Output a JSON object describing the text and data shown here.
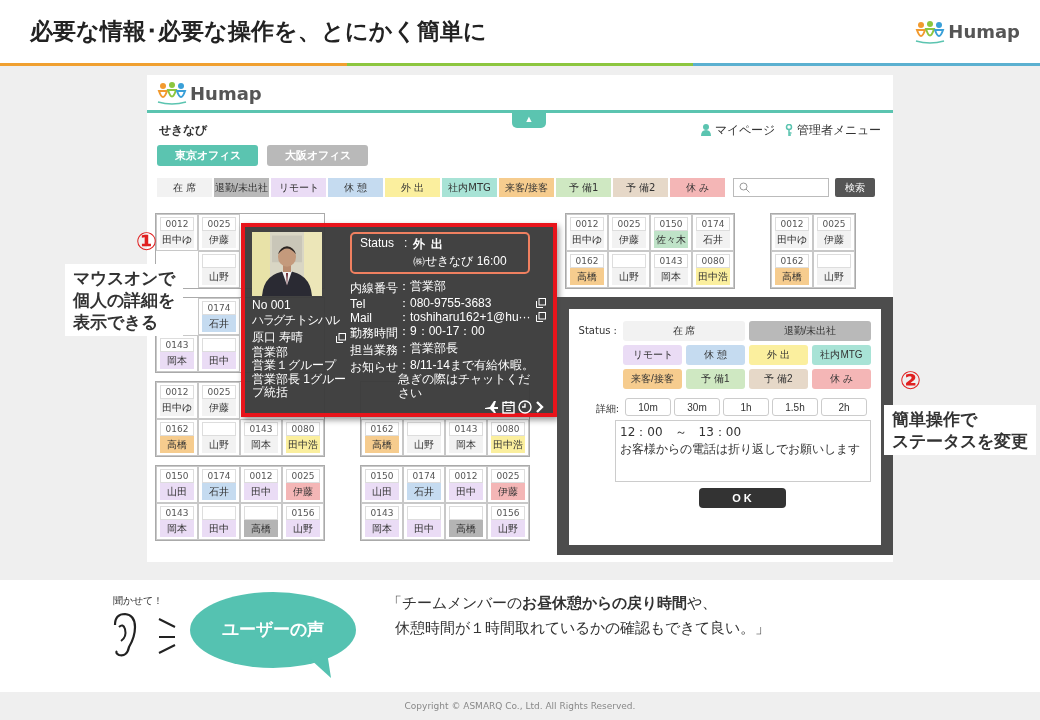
{
  "slide": {
    "title": "必要な情報･必要な操作を、とにかく簡単に",
    "brand": "Humap"
  },
  "app": {
    "brand": "Humap",
    "collapse_tab": "▲",
    "page_title": "せきなび",
    "nav": [
      {
        "label": "マイページ",
        "kind": "user"
      },
      {
        "label": "管理者メニュー",
        "kind": "key"
      }
    ],
    "offices": [
      {
        "label": "東京オフィス",
        "selected": true
      },
      {
        "label": "大阪オフィス",
        "selected": false
      }
    ],
    "legend": [
      {
        "label": "在 席",
        "color": "#f2f2f2"
      },
      {
        "label": "退勤/未出社",
        "color": "#b9b9b9"
      },
      {
        "label": "リモート",
        "color": "#eadcf5"
      },
      {
        "label": "休 憩",
        "color": "#c5dbf0"
      },
      {
        "label": "外 出",
        "color": "#fbef9e"
      },
      {
        "label": "社内MTG",
        "color": "#a8e3d6"
      },
      {
        "label": "来客/接客",
        "color": "#f6cc8e"
      },
      {
        "label": "予 備1",
        "color": "#cfe8c2"
      },
      {
        "label": "予 備2",
        "color": "#e6d8c8"
      },
      {
        "label": "休 み",
        "color": "#f4b6b6"
      }
    ],
    "search": {
      "button": "検索"
    },
    "desk_rows": [
      [
        {
          "cells": [
            {
              "no": "0012",
              "name": "田中ゆ",
              "color": "#f2f2f2"
            },
            {
              "no": "0025",
              "name": "伊藤",
              "color": "#f2f2f2"
            },
            null,
            null,
            null,
            {
              "name": "山野",
              "color": "#f2f2f2"
            },
            null,
            null
          ]
        },
        null,
        {
          "cells": [
            {
              "no": "0012",
              "name": "田中ゆ",
              "color": "#f2f2f2"
            },
            {
              "no": "0025",
              "name": "伊藤",
              "color": "#f2f2f2"
            },
            {
              "no": "0150",
              "name": "佐々木",
              "color": "#bfe3c8"
            },
            {
              "no": "0174",
              "name": "石井",
              "color": "#f2f2f2"
            },
            {
              "no": "0162",
              "name": "高橋",
              "color": "#f6cc8e"
            },
            {
              "name": "山野",
              "color": "#f2f2f2"
            },
            {
              "no": "0143",
              "name": "岡本",
              "color": "#f2f2f2"
            },
            {
              "no": "0080",
              "name": "田中浩",
              "color": "#fbef9e"
            }
          ]
        },
        {
          "cells": [
            {
              "no": "0012",
              "name": "田中ゆ",
              "color": "#f2f2f2"
            },
            {
              "no": "0025",
              "name": "伊藤",
              "color": "#f2f2f2"
            },
            {
              "no": "0162",
              "name": "高橋",
              "color": "#f6cc8e"
            },
            {
              "name": "山野",
              "color": "#f2f2f2"
            }
          ]
        }
      ],
      [
        {
          "cells": [
            null,
            {
              "no": "0174",
              "name": "石井",
              "color": "#c5dbf0"
            },
            null,
            null,
            {
              "no": "0143",
              "name": "岡本",
              "color": "#eadcf5"
            },
            {
              "name": "田中",
              "color": "#eadcf5"
            },
            null,
            null
          ]
        },
        null,
        null,
        null
      ],
      [
        {
          "cells": [
            {
              "no": "0012",
              "name": "田中ゆ",
              "color": "#f2f2f2"
            },
            {
              "no": "0025",
              "name": "伊藤",
              "color": "#f2f2f2"
            },
            null,
            null,
            {
              "no": "0162",
              "name": "高橋",
              "color": "#f6cc8e"
            },
            {
              "name": "山野",
              "color": "#f2f2f2"
            },
            {
              "no": "0143",
              "name": "岡本",
              "color": "#f2f2f2"
            },
            {
              "no": "0080",
              "name": "田中浩",
              "color": "#fbef9e"
            }
          ]
        },
        {
          "cells": [
            null,
            null,
            null,
            null,
            {
              "no": "0162",
              "name": "高橋",
              "color": "#f6cc8e"
            },
            {
              "name": "山野",
              "color": "#f2f2f2"
            },
            {
              "no": "0143",
              "name": "岡本",
              "color": "#f2f2f2"
            },
            {
              "no": "0080",
              "name": "田中浩",
              "color": "#fbef9e"
            }
          ]
        },
        null,
        null
      ],
      [
        {
          "cells": [
            {
              "no": "0150",
              "name": "山田",
              "color": "#eadcf5"
            },
            {
              "no": "0174",
              "name": "石井",
              "color": "#c5dbf0"
            },
            {
              "no": "0012",
              "name": "田中",
              "color": "#eadcf5"
            },
            {
              "no": "0025",
              "name": "伊藤",
              "color": "#f4b6b6"
            },
            {
              "no": "0143",
              "name": "岡本",
              "color": "#eadcf5"
            },
            {
              "name": "田中",
              "color": "#eadcf5"
            },
            {
              "name": "高橋",
              "color": "#b4b4b4"
            },
            {
              "no": "0156",
              "name": "山野",
              "color": "#eadcf5"
            }
          ]
        },
        {
          "cells": [
            {
              "no": "0150",
              "name": "山田",
              "color": "#eadcf5"
            },
            {
              "no": "0174",
              "name": "石井",
              "color": "#c5dbf0"
            },
            {
              "no": "0012",
              "name": "田中",
              "color": "#eadcf5"
            },
            {
              "no": "0025",
              "name": "伊藤",
              "color": "#f4b6b6"
            },
            {
              "no": "0143",
              "name": "岡本",
              "color": "#eadcf5"
            },
            {
              "name": "田中",
              "color": "#eadcf5"
            },
            {
              "name": "高橋",
              "color": "#b4b4b4"
            },
            {
              "no": "0156",
              "name": "山野",
              "color": "#eadcf5"
            }
          ]
        },
        null,
        null
      ]
    ]
  },
  "profile_popup": {
    "number": "No 001",
    "kana": "ハラグチ トシハル",
    "name": "原口 寿晴",
    "department_lines": [
      "営業部",
      "営業１グループ",
      "営業部長 1グループ統括"
    ],
    "status_label": "Status",
    "status_separator": ":",
    "status": "外 出",
    "status_detail": "㈱せきなび 16:00",
    "fields": [
      {
        "label": "内線番号",
        "value": "：営業部",
        "copy": false
      },
      {
        "label": "Tel",
        "value": "：080-9755-3683",
        "copy": true
      },
      {
        "label": "Mail",
        "value": "：toshiharu162+1@hu···",
        "copy": true
      },
      {
        "label": "勤務時間",
        "value": "：9：00-17：00",
        "copy": false
      },
      {
        "label": "担当業務",
        "value": "：営業部長",
        "copy": false
      },
      {
        "label": "お知らせ",
        "value": "：8/11-14まで有給休暇。急ぎの際はチャットください",
        "copy": false
      }
    ]
  },
  "status_dialog": {
    "status_label": "Status :",
    "statuses": [
      {
        "label": "在 席",
        "color": "#f2f2f2",
        "kind": "wide"
      },
      {
        "label": "退勤/未出社",
        "color": "#b9b9b9",
        "kind": "wide"
      },
      {
        "label": "リモート",
        "color": "#eadcf5",
        "kind": "normal"
      },
      {
        "label": "休 憩",
        "color": "#c5dbf0",
        "kind": "normal"
      },
      {
        "label": "外 出",
        "color": "#fbef9e",
        "kind": "normal"
      },
      {
        "label": "社内MTG",
        "color": "#a8e3d6",
        "kind": "normal"
      },
      {
        "label": "来客/接客",
        "color": "#f6cc8e",
        "kind": "normal"
      },
      {
        "label": "予 備1",
        "color": "#cfe8c2",
        "kind": "normal"
      },
      {
        "label": "予 備2",
        "color": "#e6d8c8",
        "kind": "normal"
      },
      {
        "label": "休 み",
        "color": "#f4b6b6",
        "kind": "normal"
      }
    ],
    "detail_label": "詳細:",
    "durations": [
      "10m",
      "30m",
      "1h",
      "1.5h",
      "2h"
    ],
    "note": "12：00　～　13：00\nお客様からの電話は折り返しでお願いします",
    "ok": "O K"
  },
  "callouts": [
    {
      "number": "①",
      "lines": [
        "マウスオンで",
        "個人の詳細を",
        "表示できる"
      ]
    },
    {
      "number": "②",
      "lines": [
        "簡単操作で",
        "ステータスを変更"
      ]
    }
  ],
  "voice": {
    "prompt": "聞かせて！",
    "bubble": "ユーザーの声",
    "quote_lines": [
      "「チームメンバーの**お昼休憩からの戻り時間**や、",
      "休憩時間が１時間取れているかの確認もできて良い。」"
    ]
  },
  "footer": "Copyright © ASMARQ Co., Ltd. All Rights Reserved."
}
